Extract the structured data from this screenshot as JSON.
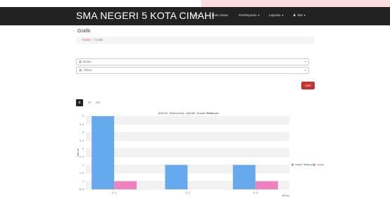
{
  "header": {
    "brand": "SMA NEGERI 5 KOTA CIMAHI",
    "nav": [
      {
        "label": "Home",
        "dropdown": false
      },
      {
        "label": "Data Siswa",
        "dropdown": false
      },
      {
        "label": "Pembayaran",
        "dropdown": true
      },
      {
        "label": "Laporan",
        "dropdown": true
      },
      {
        "label": "Ikat",
        "dropdown": true,
        "icon": "user-icon"
      }
    ]
  },
  "page": {
    "title": "Grafik",
    "breadcrumb": {
      "home": "Home",
      "sep": "/",
      "current": "Grafik"
    }
  },
  "filters": {
    "bulan_placeholder": "Bulan",
    "tahun_placeholder": "Tahun",
    "calendar_icon": "calendar-icon"
  },
  "actions": {
    "cari_label": "Cari"
  },
  "tabs": [
    "B",
    "M",
    "SO"
  ],
  "chart_data": {
    "type": "bar",
    "title": "Grafik Statistik Jumlah Siswa Membayar",
    "ylabel": "Jumlah",
    "xlabel": "Kelas",
    "categories": [
      "X-1",
      "X-2",
      "X-3"
    ],
    "series": [
      {
        "name": "Sudah Membayar",
        "color": "#66aaee",
        "values": [
          5,
          2,
          2
        ]
      },
      {
        "name": "Lunas",
        "color": "#f080c0",
        "values": [
          1,
          0,
          1
        ]
      }
    ],
    "yticks": [
      "0.5",
      "1",
      "1.5",
      "2",
      "2.5",
      "3",
      "3.5",
      "4",
      "4.5",
      "5"
    ],
    "ylim": [
      0.5,
      5
    ],
    "grid": true,
    "legend_position": "right"
  }
}
